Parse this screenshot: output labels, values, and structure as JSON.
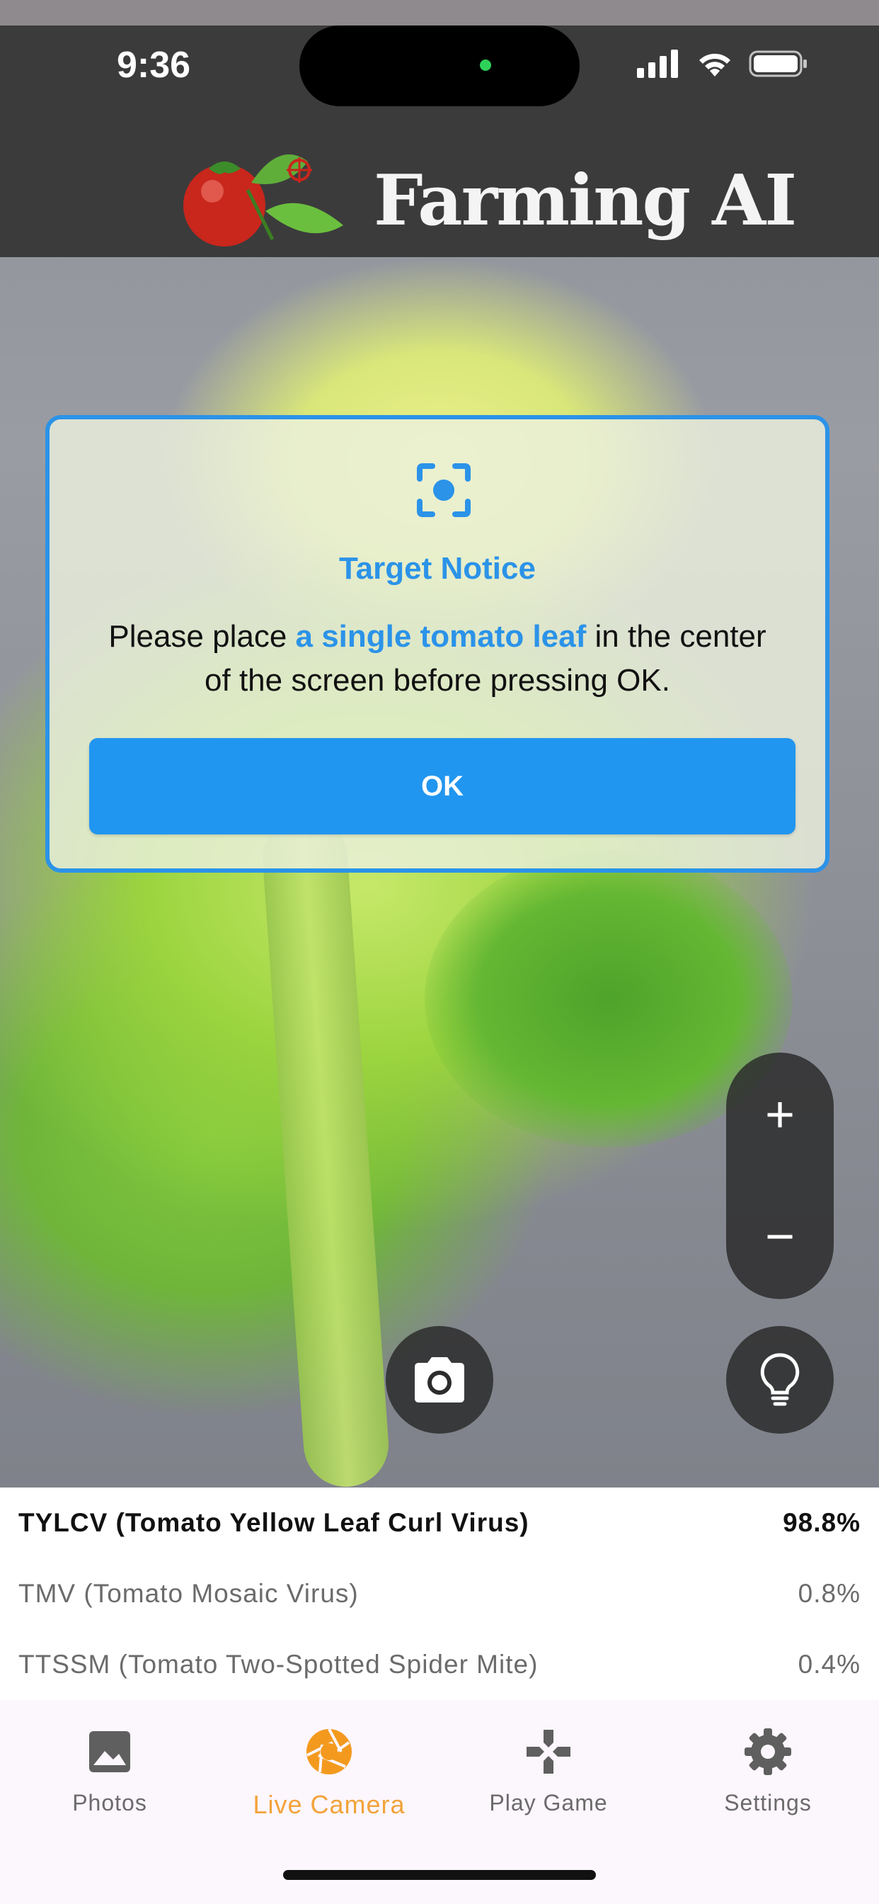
{
  "status_bar": {
    "time": "9:36"
  },
  "header": {
    "brand": "Farming AI"
  },
  "dialog": {
    "title": "Target Notice",
    "message_pre": "Please place ",
    "message_highlight": "a single tomato leaf",
    "message_post": " in the center of the screen before pressing OK.",
    "ok_label": "OK"
  },
  "controls": {
    "zoom_in": "+",
    "zoom_out": "−"
  },
  "results": [
    {
      "label": "TYLCV (Tomato Yellow Leaf Curl Virus)",
      "value": "98.8%"
    },
    {
      "label": "TMV (Tomato Mosaic Virus)",
      "value": "0.8%"
    },
    {
      "label": "TTSSM (Tomato Two-Spotted Spider Mite)",
      "value": "0.4%"
    }
  ],
  "tabs": [
    {
      "label": "Photos",
      "icon": "photo-icon"
    },
    {
      "label": "Live Camera",
      "icon": "camera-aperture-icon",
      "active": true
    },
    {
      "label": "Play Game",
      "icon": "gamepad-icon"
    },
    {
      "label": "Settings",
      "icon": "gear-icon"
    }
  ],
  "colors": {
    "accent": "#2196f0",
    "active_tab": "#f2a33a"
  }
}
